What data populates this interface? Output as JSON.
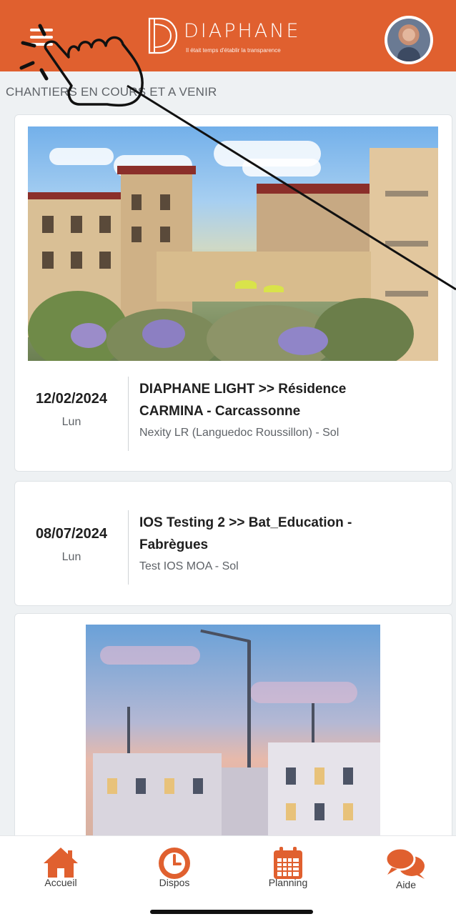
{
  "header": {
    "logo_text": "DIAPHANE",
    "tagline": "Il était temps d'établir la transparence",
    "menu_icon": "hamburger-menu-icon",
    "avatar_icon": "user-avatar"
  },
  "section_title": "CHANTIERS EN COURS ET A VENIR",
  "cards": [
    {
      "date": "12/02/2024",
      "day": "Lun",
      "title_line1": "DIAPHANE LIGHT >> Résidence",
      "title_line2": "CARMINA - Carcassonne",
      "subtitle": "Nexity LR (Languedoc Roussillon) - Sol"
    },
    {
      "date": "08/07/2024",
      "day": "Lun",
      "title_line1": "IOS Testing 2 >> Bat_Education -",
      "title_line2": "Fabrègues",
      "subtitle": "Test IOS MOA - Sol"
    }
  ],
  "nav": [
    {
      "label": "Accueil",
      "icon": "home-icon"
    },
    {
      "label": "Dispos",
      "icon": "clock-icon"
    },
    {
      "label": "Planning",
      "icon": "calendar-icon"
    },
    {
      "label": "Aide",
      "icon": "chat-bubbles-icon"
    }
  ],
  "colors": {
    "accent": "#e0602f",
    "background": "#eef1f3"
  }
}
